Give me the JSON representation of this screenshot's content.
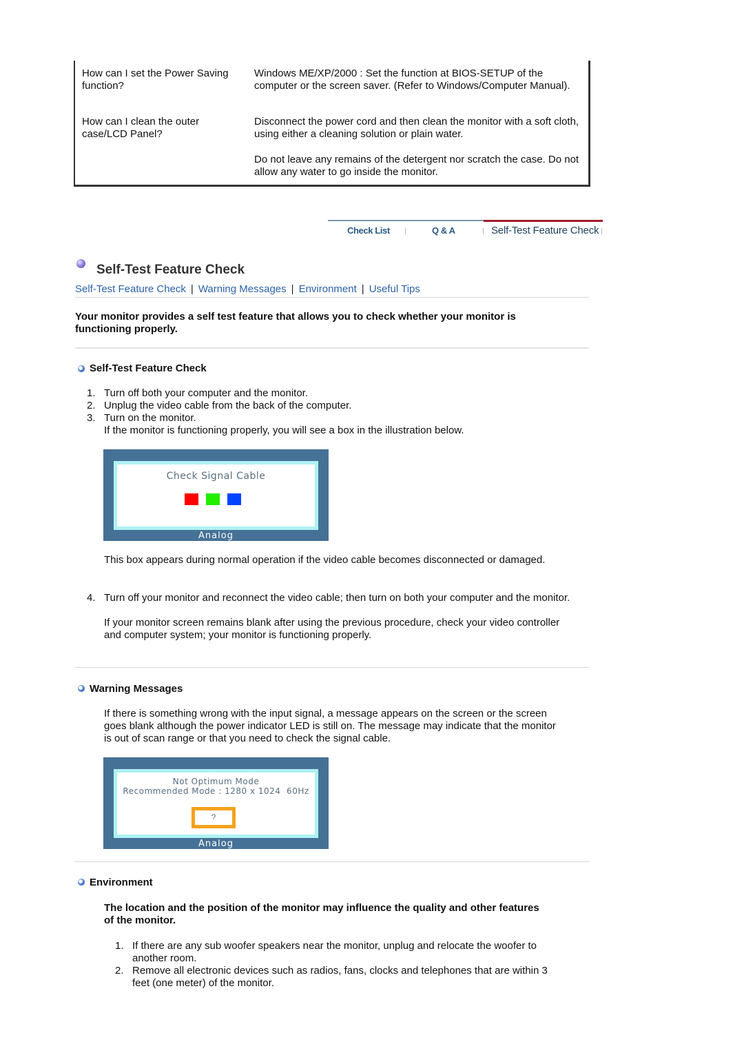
{
  "qa_table": {
    "rows": [
      {
        "question": "How can I set the Power Saving function?",
        "answers": [
          "Windows ME/XP/2000 : Set the function at BIOS-SETUP of the computer or the screen saver. (Refer to Windows/Computer Manual)."
        ]
      },
      {
        "question": "How can I clean the outer case/LCD Panel?",
        "answers": [
          "Disconnect the power cord and then clean the monitor with a soft cloth, using either a cleaning solution or plain water.",
          "Do not leave any remains of the detergent nor scratch the case. Do not allow any water to go inside the monitor."
        ]
      }
    ]
  },
  "tabnav": {
    "tabs": [
      {
        "label": "Check List",
        "active": false
      },
      {
        "label": "Q & A",
        "active": false
      },
      {
        "label": "Self-Test Feature Check",
        "active": true
      }
    ],
    "colors": {
      "active_line": "#a01c2a",
      "inactive_line": "#7b95a8"
    }
  },
  "page": {
    "title": "Self-Test Feature Check",
    "links": [
      "Self-Test Feature Check",
      "Warning Messages",
      "Environment",
      "Useful Tips"
    ],
    "link_separator": "|",
    "intro": "Your monitor provides a self test feature that allows you to check whether your monitor is functioning properly."
  },
  "self_test": {
    "heading": "Self-Test Feature Check",
    "steps": [
      {
        "num": "1.",
        "text": "Turn off both your computer and the monitor."
      },
      {
        "num": "2.",
        "text": "Unplug the video cable from the back of the computer."
      },
      {
        "num": "3.",
        "text": "Turn on the monitor."
      }
    ],
    "step3_note": "If the monitor is functioning properly, you will see a box in the illustration below.",
    "osd": {
      "message": "Check Signal Cable",
      "footer": "Analog",
      "squares": [
        "#ff0000",
        "#22ee00",
        "#0044ff"
      ]
    },
    "osd_caption": "This box appears during normal operation if the video cable becomes disconnected or damaged.",
    "step4": {
      "num": "4.",
      "text": "Turn off your monitor and reconnect the video cable; then turn on both your computer and the monitor."
    },
    "step4_note": "If your monitor screen remains blank after using the previous procedure, check your video controller and computer system; your monitor is functioning properly."
  },
  "warning": {
    "heading": "Warning Messages",
    "text": "If there is something wrong with the input signal, a message appears on the screen or the screen goes blank although the power indicator LED is still on. The message may indicate that the monitor is out of scan range or that you need to check the signal cable.",
    "osd": {
      "line1": "Not Optimum Mode",
      "line2": "Recommended Mode : 1280 x 1024  60Hz",
      "button": "?",
      "footer": "Analog",
      "button_color": "#f5a21c"
    }
  },
  "environment": {
    "heading": "Environment",
    "intro": "The location and the position of the monitor may influence the quality and other features of the monitor.",
    "items": [
      {
        "num": "1.",
        "text": "If there are any sub woofer speakers near the monitor, unplug and relocate the woofer to another room."
      },
      {
        "num": "2.",
        "text": "Remove all electronic devices such as radios, fans, clocks and telephones that are within 3 feet (one meter) of the monitor."
      }
    ]
  }
}
